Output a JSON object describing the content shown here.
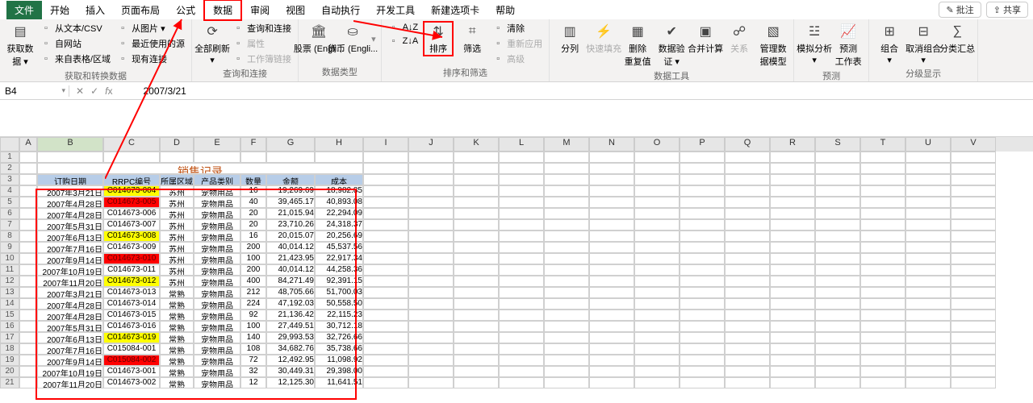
{
  "menu": {
    "file": "文件",
    "tabs": [
      "开始",
      "插入",
      "页面布局",
      "公式",
      "数据",
      "审阅",
      "视图",
      "自动执行",
      "开发工具",
      "新建选项卡",
      "帮助"
    ],
    "active_index": 4,
    "right": {
      "comments": "批注",
      "share": "共享"
    }
  },
  "ribbon": {
    "groups": [
      {
        "label": "获取和转换数据",
        "big": [
          {
            "icon": "db",
            "label": "获取数\n据 ▾"
          }
        ],
        "small": [
          "从文本/CSV",
          "自网站",
          "来自表格/区域",
          "从图片 ▾",
          "最近使用的源",
          "现有连接"
        ]
      },
      {
        "label": "查询和连接",
        "big": [
          {
            "icon": "refresh",
            "label": "全部刷新\n▾"
          }
        ],
        "small": [
          "查询和连接",
          "属性",
          "工作簿链接"
        ]
      },
      {
        "label": "数据类型",
        "big": [
          {
            "icon": "bank",
            "label": "股票 (Engli..."
          },
          {
            "icon": "coins",
            "label": "货币 (Engli..."
          }
        ],
        "caret": "▾"
      },
      {
        "label": "排序和筛选",
        "small_left": [
          "A↓Z",
          "Z↓A"
        ],
        "big": [
          {
            "icon": "sort",
            "label": "排序",
            "highlight": true
          },
          {
            "icon": "filter",
            "label": "筛选"
          }
        ],
        "small_right": [
          "清除",
          "重新应用",
          "高级"
        ]
      },
      {
        "label": "数据工具",
        "big": [
          {
            "icon": "columns",
            "label": "分列"
          },
          {
            "icon": "flash",
            "label": "快速填充",
            "disabled": true
          },
          {
            "icon": "dedupe",
            "label": "删除\n重复值"
          },
          {
            "icon": "validate",
            "label": "数据验\n证 ▾"
          },
          {
            "icon": "consol",
            "label": "合并计算"
          },
          {
            "icon": "relation",
            "label": "关系",
            "disabled": true
          },
          {
            "icon": "model",
            "label": "管理数\n据模型"
          }
        ]
      },
      {
        "label": "预测",
        "big": [
          {
            "icon": "whatif",
            "label": "模拟分析\n▾"
          },
          {
            "icon": "forecast",
            "label": "预测\n工作表"
          }
        ]
      },
      {
        "label": "分级显示",
        "big": [
          {
            "icon": "group",
            "label": "组合\n▾"
          },
          {
            "icon": "ungroup",
            "label": "取消组合\n▾"
          },
          {
            "icon": "subtotal",
            "label": "分类汇总"
          }
        ]
      }
    ]
  },
  "formula_bar": {
    "name": "B4",
    "value": "2007/3/21"
  },
  "sheet": {
    "columns": [
      "A",
      "B",
      "C",
      "D",
      "E",
      "F",
      "G",
      "H",
      "I",
      "J",
      "K",
      "L",
      "M",
      "N",
      "O",
      "P",
      "Q",
      "R",
      "S",
      "T",
      "U",
      "V"
    ],
    "title": "销售记录",
    "headers": [
      "订购日期",
      "RRPC编号",
      "所属区域",
      "产品类别",
      "数量",
      "金额",
      "成本"
    ],
    "rows": [
      {
        "n": 4,
        "date": "2007年3月21日",
        "rrpc": "C014673-004",
        "rrpc_color": "yellow",
        "region": "苏州",
        "cat": "宠物用品",
        "qty": "16",
        "amt": "19,269.69",
        "cost": "18,982.85"
      },
      {
        "n": 5,
        "date": "2007年4月28日",
        "rrpc": "C014673-005",
        "rrpc_color": "red",
        "region": "苏州",
        "cat": "宠物用品",
        "qty": "40",
        "amt": "39,465.17",
        "cost": "40,893.08"
      },
      {
        "n": 6,
        "date": "2007年4月28日",
        "rrpc": "C014673-006",
        "rrpc_color": "",
        "region": "苏州",
        "cat": "宠物用品",
        "qty": "20",
        "amt": "21,015.94",
        "cost": "22,294.09"
      },
      {
        "n": 7,
        "date": "2007年5月31日",
        "rrpc": "C014673-007",
        "rrpc_color": "",
        "region": "苏州",
        "cat": "宠物用品",
        "qty": "20",
        "amt": "23,710.26",
        "cost": "24,318.37"
      },
      {
        "n": 8,
        "date": "2007年6月13日",
        "rrpc": "C014673-008",
        "rrpc_color": "yellow",
        "region": "苏州",
        "cat": "宠物用品",
        "qty": "16",
        "amt": "20,015.07",
        "cost": "20,256.69"
      },
      {
        "n": 9,
        "date": "2007年7月16日",
        "rrpc": "C014673-009",
        "rrpc_color": "",
        "region": "苏州",
        "cat": "宠物用品",
        "qty": "200",
        "amt": "40,014.12",
        "cost": "45,537.56"
      },
      {
        "n": 10,
        "date": "2007年9月14日",
        "rrpc": "C014673-010",
        "rrpc_color": "red",
        "region": "苏州",
        "cat": "宠物用品",
        "qty": "100",
        "amt": "21,423.95",
        "cost": "22,917.34"
      },
      {
        "n": 11,
        "date": "2007年10月19日",
        "rrpc": "C014673-011",
        "rrpc_color": "",
        "region": "苏州",
        "cat": "宠物用品",
        "qty": "200",
        "amt": "40,014.12",
        "cost": "44,258.36"
      },
      {
        "n": 12,
        "date": "2007年11月20日",
        "rrpc": "C014673-012",
        "rrpc_color": "yellow",
        "region": "苏州",
        "cat": "宠物用品",
        "qty": "400",
        "amt": "84,271.49",
        "cost": "92,391.15"
      },
      {
        "n": 13,
        "date": "2007年3月21日",
        "rrpc": "C014673-013",
        "rrpc_color": "",
        "region": "常熟",
        "cat": "宠物用品",
        "qty": "212",
        "amt": "48,705.66",
        "cost": "51,700.03"
      },
      {
        "n": 14,
        "date": "2007年4月28日",
        "rrpc": "C014673-014",
        "rrpc_color": "",
        "region": "常熟",
        "cat": "宠物用品",
        "qty": "224",
        "amt": "47,192.03",
        "cost": "50,558.50"
      },
      {
        "n": 15,
        "date": "2007年4月28日",
        "rrpc": "C014673-015",
        "rrpc_color": "",
        "region": "常熟",
        "cat": "宠物用品",
        "qty": "92",
        "amt": "21,136.42",
        "cost": "22,115.23"
      },
      {
        "n": 16,
        "date": "2007年5月31日",
        "rrpc": "C014673-016",
        "rrpc_color": "",
        "region": "常熟",
        "cat": "宠物用品",
        "qty": "100",
        "amt": "27,449.51",
        "cost": "30,712.18"
      },
      {
        "n": 17,
        "date": "2007年6月13日",
        "rrpc": "C014673-019",
        "rrpc_color": "yellow",
        "region": "常熟",
        "cat": "宠物用品",
        "qty": "140",
        "amt": "29,993.53",
        "cost": "32,726.66"
      },
      {
        "n": 18,
        "date": "2007年7月16日",
        "rrpc": "C015084-001",
        "rrpc_color": "",
        "region": "常熟",
        "cat": "宠物用品",
        "qty": "108",
        "amt": "34,682.76",
        "cost": "35,738.66"
      },
      {
        "n": 19,
        "date": "2007年9月14日",
        "rrpc": "C015084-002",
        "rrpc_color": "red",
        "region": "常熟",
        "cat": "宠物用品",
        "qty": "72",
        "amt": "12,492.95",
        "cost": "11,098.92"
      },
      {
        "n": 20,
        "date": "2007年10月19日",
        "rrpc": "C014673-001",
        "rrpc_color": "",
        "region": "常熟",
        "cat": "宠物用品",
        "qty": "32",
        "amt": "30,449.31",
        "cost": "29,398.00"
      },
      {
        "n": 21,
        "date": "2007年11月20日",
        "rrpc": "C014673-002",
        "rrpc_color": "",
        "region": "常熟",
        "cat": "宠物用品",
        "qty": "12",
        "amt": "12,125.30",
        "cost": "11,641.51"
      }
    ]
  }
}
